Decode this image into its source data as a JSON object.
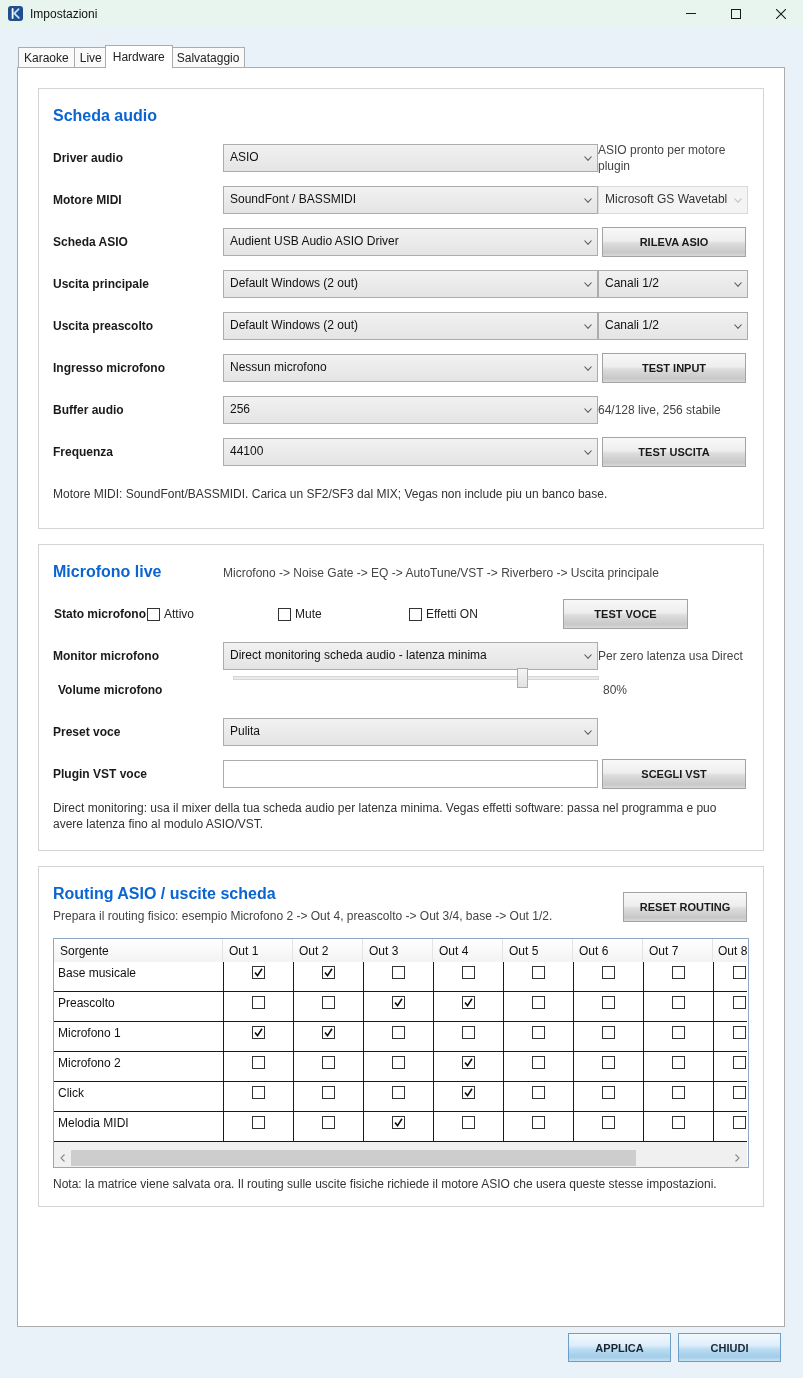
{
  "window": {
    "title": "Impostazioni"
  },
  "tabs": [
    {
      "label": "Karaoke",
      "selected": false
    },
    {
      "label": "Live",
      "selected": false
    },
    {
      "label": "Hardware",
      "selected": true
    },
    {
      "label": "Salvataggio",
      "selected": false
    }
  ],
  "sections": [
    {
      "kind": "form",
      "title": "Scheda audio",
      "rows": [
        {
          "kind": "dropdown",
          "label": "Driver audio",
          "value": "ASIO",
          "side": {
            "kind": "note",
            "text": "ASIO pronto per motore plugin"
          }
        },
        {
          "kind": "dropdown",
          "label": "Motore MIDI",
          "value": "SoundFont / BASSMIDI",
          "side": {
            "kind": "dropdown",
            "value": "Microsoft GS Wavetabl",
            "disabled": true
          }
        },
        {
          "kind": "dropdown",
          "label": "Scheda ASIO",
          "value": "Audient USB Audio ASIO Driver",
          "side": {
            "kind": "button",
            "label": "RILEVA ASIO"
          }
        },
        {
          "kind": "dropdown",
          "label": "Uscita principale",
          "value": "Default Windows (2 out)",
          "side": {
            "kind": "dropdown",
            "value": "Canali 1/2",
            "disabled": false
          }
        },
        {
          "kind": "dropdown",
          "label": "Uscita preascolto",
          "value": "Default Windows (2 out)",
          "side": {
            "kind": "dropdown",
            "value": "Canali 1/2",
            "disabled": false
          }
        },
        {
          "kind": "dropdown",
          "label": "Ingresso microfono",
          "value": "Nessun microfono",
          "side": {
            "kind": "button",
            "label": "TEST INPUT"
          }
        },
        {
          "kind": "dropdown",
          "label": "Buffer audio",
          "value": "256",
          "side": {
            "kind": "note",
            "text": "64/128 live, 256 stabile"
          }
        },
        {
          "kind": "dropdown",
          "label": "Frequenza",
          "value": "44100",
          "side": {
            "kind": "button",
            "label": "TEST USCITA"
          }
        }
      ],
      "note": "Motore MIDI: SoundFont/BASSMIDI. Carica un SF2/SF3 dal MIX; Vegas non include piu un banco base."
    },
    {
      "kind": "form",
      "title": "Microfono live",
      "subtitle": "Microfono -> Noise Gate -> EQ -> AutoTune/VST -> Riverbero -> Uscita principale",
      "rows": [
        {
          "kind": "checks",
          "label": "Stato microfono",
          "checks": [
            {
              "label": "Attivo",
              "checked": false
            },
            {
              "label": "Mute",
              "checked": false
            },
            {
              "label": "Effetti ON",
              "checked": false
            }
          ],
          "side": {
            "kind": "button",
            "label": "TEST VOCE"
          }
        },
        {
          "kind": "dropdown",
          "label": "Monitor microfono",
          "value": "Direct monitoring scheda audio - latenza minima",
          "side": {
            "kind": "note",
            "text": "Per zero latenza usa Direct"
          }
        },
        {
          "kind": "slider",
          "label": "Volume microfono",
          "level": 0.8,
          "reading": "80%"
        },
        {
          "kind": "dropdown",
          "label": "Preset voce",
          "value": "Pulita"
        },
        {
          "kind": "field",
          "label": "Plugin VST voce",
          "side": {
            "kind": "button",
            "label": "SCEGLI VST"
          }
        }
      ],
      "note": "Direct monitoring: usa il mixer della tua scheda audio per latenza minima. Vegas effetti software: passa nel programma e puo avere latenza fino al modulo ASIO/VST."
    },
    {
      "kind": "matrix",
      "title": "Routing ASIO / uscite scheda",
      "subtitle": "Prepara il routing fisico: esempio Microfono 2 -> Out 4, preascolto -> Out 3/4, base -> Out 1/2.",
      "button": "RESET ROUTING",
      "table": {
        "columns": [
          "Sorgente",
          "Out 1",
          "Out 2",
          "Out 3",
          "Out 4",
          "Out 5",
          "Out 6",
          "Out 7",
          "Out 8"
        ],
        "rows": [
          {
            "source": "Base musicale",
            "outputs": [
              {
                "checked": true
              },
              {
                "checked": true
              },
              {
                "checked": false
              },
              {
                "checked": false
              },
              {
                "checked": false
              },
              {
                "checked": false
              },
              {
                "checked": false
              },
              {
                "checked": false
              }
            ]
          },
          {
            "source": "Preascolto",
            "outputs": [
              {
                "checked": false
              },
              {
                "checked": false
              },
              {
                "checked": true
              },
              {
                "checked": true
              },
              {
                "checked": false
              },
              {
                "checked": false
              },
              {
                "checked": false
              },
              {
                "checked": false
              }
            ]
          },
          {
            "source": "Microfono 1",
            "outputs": [
              {
                "checked": true
              },
              {
                "checked": true
              },
              {
                "checked": false
              },
              {
                "checked": false
              },
              {
                "checked": false
              },
              {
                "checked": false
              },
              {
                "checked": false
              },
              {
                "checked": false
              }
            ]
          },
          {
            "source": "Microfono 2",
            "outputs": [
              {
                "checked": false
              },
              {
                "checked": false
              },
              {
                "checked": false
              },
              {
                "checked": true
              },
              {
                "checked": false
              },
              {
                "checked": false
              },
              {
                "checked": false
              },
              {
                "checked": false
              }
            ]
          },
          {
            "source": "Click",
            "outputs": [
              {
                "checked": false
              },
              {
                "checked": false
              },
              {
                "checked": false
              },
              {
                "checked": true
              },
              {
                "checked": false
              },
              {
                "checked": false
              },
              {
                "checked": false
              },
              {
                "checked": false
              }
            ]
          },
          {
            "source": "Melodia MIDI",
            "outputs": [
              {
                "checked": false
              },
              {
                "checked": false
              },
              {
                "checked": true
              },
              {
                "checked": false
              },
              {
                "checked": false
              },
              {
                "checked": false
              },
              {
                "checked": false
              },
              {
                "checked": false
              }
            ]
          }
        ]
      },
      "note": "Nota: la matrice viene salvata ora. Il routing sulle uscite fisiche richiede il motore ASIO che usera queste stesse impostazioni."
    }
  ],
  "buttons": [
    {
      "label": "APPLICA"
    },
    {
      "label": "CHIUDI"
    }
  ]
}
